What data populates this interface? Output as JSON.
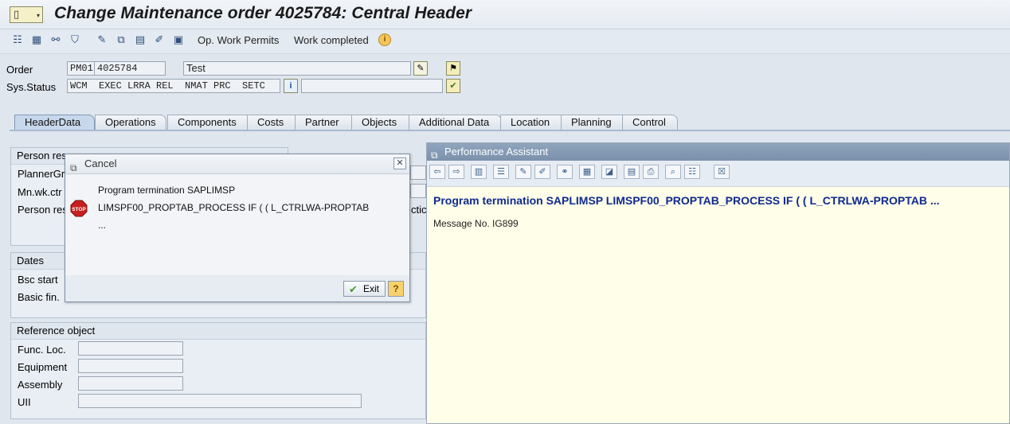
{
  "window": {
    "title": "Change Maintenance order 4025784: Central Header"
  },
  "toolbar": {
    "op_work_permits": "Op. Work Permits",
    "work_completed": "Work completed"
  },
  "header": {
    "order_label": "Order",
    "order_type": "PM01",
    "order_number": "4025784",
    "order_text": "Test",
    "sys_status_label": "Sys.Status",
    "sys_status_value": "WCM  EXEC LRRA REL  NMAT PRC  SETC",
    "status_extra": ""
  },
  "tabs": [
    {
      "label": "HeaderData",
      "active": true
    },
    {
      "label": "Operations"
    },
    {
      "label": "Components"
    },
    {
      "label": "Costs"
    },
    {
      "label": "Partner"
    },
    {
      "label": "Objects"
    },
    {
      "label": "Additional Data"
    },
    {
      "label": "Location"
    },
    {
      "label": "Planning"
    },
    {
      "label": "Control"
    }
  ],
  "groups": {
    "person_responsible": {
      "title": "Person res",
      "planner_grp": "PlannerGrp",
      "mn_wk_ctr": "Mn.wk.ctr",
      "person_resp": "Person res",
      "side_text": "ctic"
    },
    "dates": {
      "title": "Dates",
      "bsc_start": "Bsc start",
      "basic_fin": "Basic fin."
    },
    "reference_object": {
      "title": "Reference object",
      "func_loc": "Func. Loc.",
      "equipment": "Equipment",
      "assembly": "Assembly",
      "uii": "UII"
    }
  },
  "performance_assistant": {
    "title": "Performance Assistant",
    "message": "Program termination SAPLIMSP LIMSPF00_PROPTAB_PROCESS IF ( ( L_CTRLWA-PROPTAB ...",
    "message_no": "Message No. IG899"
  },
  "dialog": {
    "title": "Cancel",
    "line1": "Program termination SAPLIMSP",
    "line2": "LIMSPF00_PROPTAB_PROCESS IF ( ( L_CTRLWA-PROPTAB",
    "line3": "...",
    "exit_label": "Exit"
  },
  "colors": {
    "accent": "#0f2a8f",
    "stop_red": "#c8201e"
  }
}
